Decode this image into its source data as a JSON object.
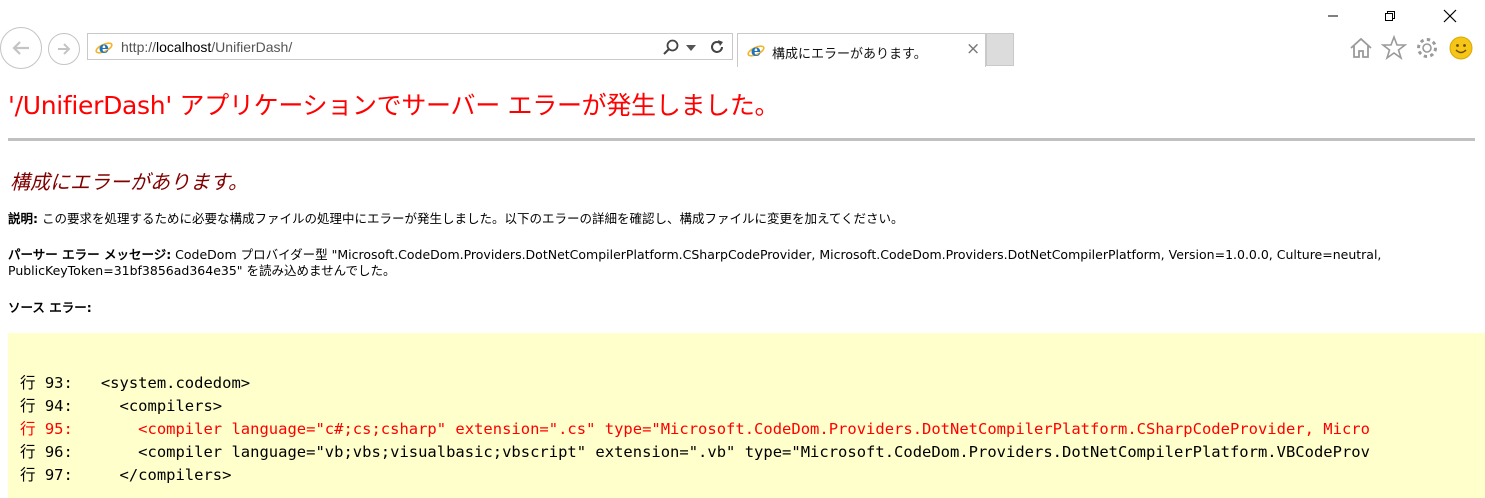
{
  "browser": {
    "url_prefix": "http://",
    "url_host": "localhost",
    "url_path": "/UnifierDash/",
    "tab_title": "構成にエラーがあります。",
    "tab_close": "×"
  },
  "page": {
    "heading": "'/UnifierDash' アプリケーションでサーバー エラーが発生しました。",
    "subheading": "構成にエラーがあります。",
    "description_label": "説明:",
    "description_text": " この要求を処理するために必要な構成ファイルの処理中にエラーが発生しました。以下のエラーの詳細を確認し、構成ファイルに変更を加えてください。",
    "parser_label": "パーサー エラー メッセージ:",
    "parser_text_1": " CodeDom プロバイダー型 \"Microsoft.CodeDom.Providers.DotNetCompilerPlatform.CSharpCodeProvider, Microsoft.CodeDom.Providers.DotNetCompilerPlatform, Version=1.0.0.0, Culture=neutral,",
    "parser_text_2": "PublicKeyToken=31bf3856ad364e35\" を読み込めませんでした。",
    "source_label": "ソース エラー:"
  },
  "source_lines": [
    {
      "text": "行 93:   <system.codedom>",
      "highlight": false
    },
    {
      "text": "行 94:     <compilers>",
      "highlight": false
    },
    {
      "text": "行 95:       <compiler language=\"c#;cs;csharp\" extension=\".cs\" type=\"Microsoft.CodeDom.Providers.DotNetCompilerPlatform.CSharpCodeProvider, Micro",
      "highlight": true
    },
    {
      "text": "行 96:       <compiler language=\"vb;vbs;visualbasic;vbscript\" extension=\".vb\" type=\"Microsoft.CodeDom.Providers.DotNetCompilerPlatform.VBCodeProv",
      "highlight": false
    },
    {
      "text": "行 97:     </compilers>",
      "highlight": false
    }
  ],
  "colors": {
    "heading": "#ff0000",
    "subheading": "#800000",
    "source_background": "#ffffcc",
    "ie_blue": "#1e73be",
    "smiley": "#f5c518"
  }
}
